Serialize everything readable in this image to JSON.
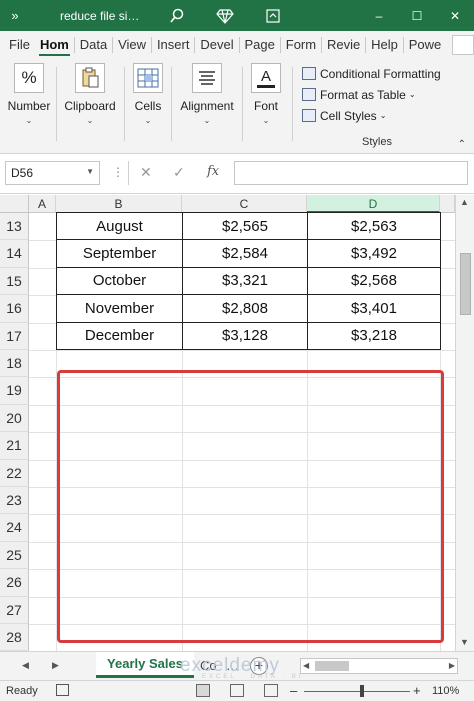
{
  "titlebar": {
    "overflow_icon": "»",
    "doc_title": "reduce file si…",
    "dropdown_icon": "▾",
    "search_icon": "search-icon",
    "diamond_icon": "diamond-icon",
    "ribbon_display_icon": "ribbon-display-icon",
    "minimize_icon": "–",
    "maximize_icon": "☐",
    "close_icon": "✕",
    "color": "#217346"
  },
  "tabs": [
    "File",
    "Hom",
    "Data",
    "View",
    "Insert",
    "Devel",
    "Page",
    "Form",
    "Revie",
    "Help",
    "Powe"
  ],
  "active_tab": "Hom",
  "ribbon": {
    "groups": [
      {
        "label": "Number",
        "icon": "%"
      },
      {
        "label": "Clipboard",
        "icon": "clipboard-icon"
      },
      {
        "label": "Cells",
        "icon": "cells-icon"
      },
      {
        "label": "Alignment",
        "icon": "alignment-icon"
      },
      {
        "label": "Font",
        "icon": "A"
      }
    ],
    "styles": {
      "items": [
        {
          "label": "Conditional Formatting"
        },
        {
          "label": "Format as Table"
        },
        {
          "label": "Cell Styles"
        }
      ],
      "group_label": "Styles"
    },
    "dropdown_glyph": "⌄",
    "collapse_glyph": "⌃"
  },
  "formula_bar": {
    "name_box": "D56",
    "cancel_glyph": "✕",
    "enter_glyph": "✓",
    "fx_label": "fx",
    "formula_value": ""
  },
  "grid": {
    "columns": [
      {
        "label": "A",
        "selected": false
      },
      {
        "label": "B",
        "selected": false
      },
      {
        "label": "C",
        "selected": false
      },
      {
        "label": "D",
        "selected": true
      }
    ],
    "rows": [
      "13",
      "14",
      "15",
      "16",
      "17",
      "18",
      "19",
      "20",
      "21",
      "22",
      "23",
      "24",
      "25",
      "26",
      "27",
      "28"
    ],
    "table_rows": [
      {
        "month": "August",
        "c": "$2,565",
        "d": "$2,563"
      },
      {
        "month": "September",
        "c": "$2,584",
        "d": "$3,492"
      },
      {
        "month": "October",
        "c": "$3,321",
        "d": "$2,568"
      },
      {
        "month": "November",
        "c": "$2,808",
        "d": "$3,401"
      },
      {
        "month": "December",
        "c": "$3,128",
        "d": "$3,218"
      }
    ],
    "highlight_color": "#d83b3b"
  },
  "sheets": {
    "active": "Yearly Sales",
    "other": "Co",
    "more": "…",
    "add_glyph": "+"
  },
  "watermark": {
    "name": "exceldemy",
    "tagline": "EXCEL · DATA · BI"
  },
  "status": {
    "ready": "Ready",
    "zoom": "110%",
    "zoom_minus": "–",
    "zoom_plus": "+"
  }
}
